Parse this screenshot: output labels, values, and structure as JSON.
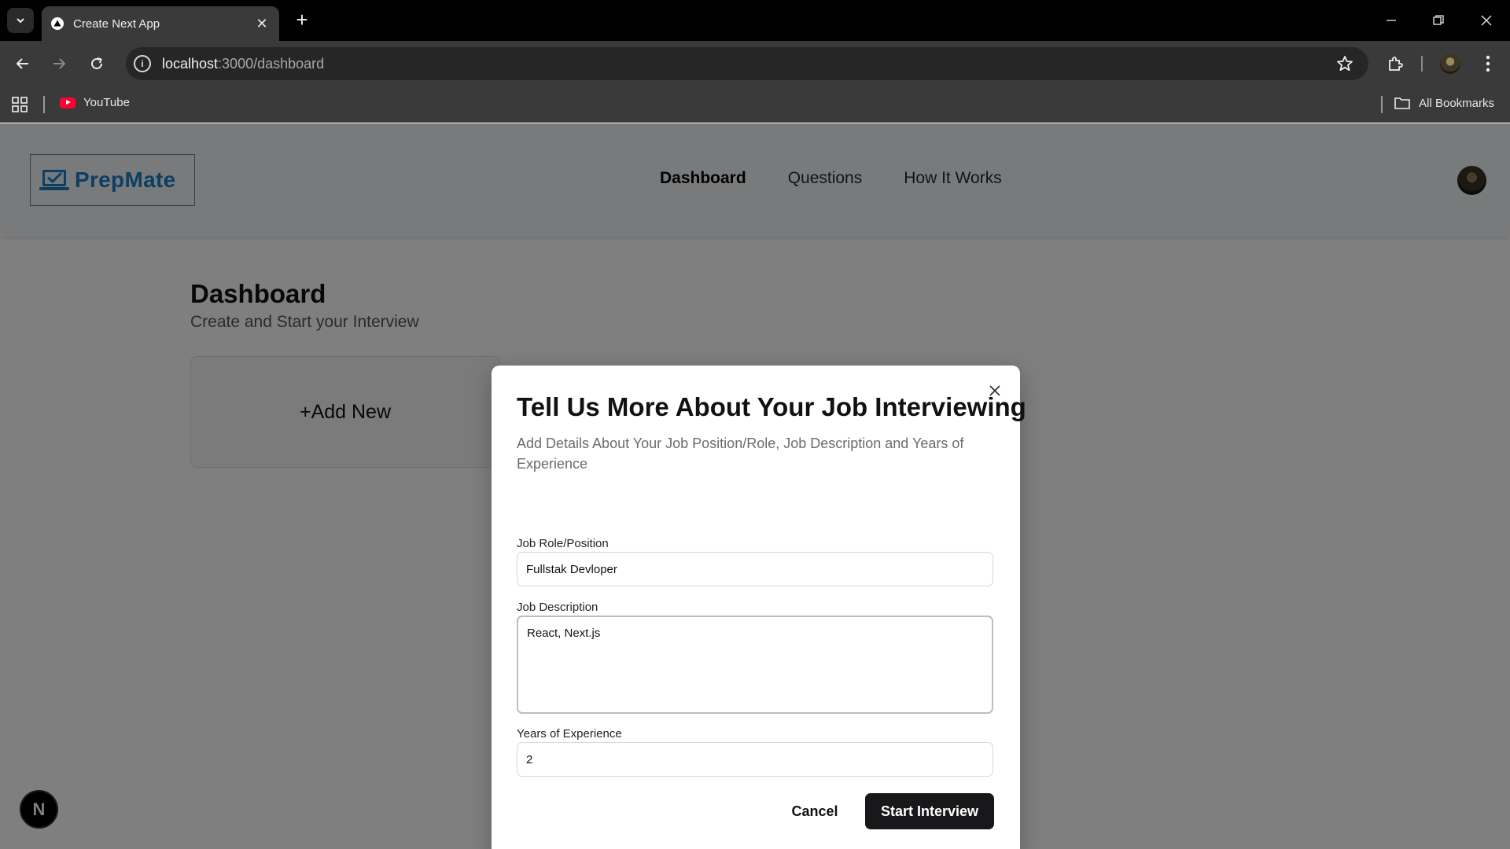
{
  "browser": {
    "tab_title": "Create Next App",
    "url_host": "localhost",
    "url_path": ":3000/dashboard",
    "bookmarks": [
      {
        "label": "YouTube"
      }
    ],
    "all_bookmarks_label": "All Bookmarks"
  },
  "header": {
    "logo_text": "PrepMate",
    "nav": [
      {
        "label": "Dashboard",
        "active": true
      },
      {
        "label": "Questions",
        "active": false
      },
      {
        "label": "How It Works",
        "active": false
      }
    ]
  },
  "dashboard": {
    "title": "Dashboard",
    "subtitle": "Create and Start your Interview",
    "add_new_label": "+Add New"
  },
  "next_badge": "N",
  "modal": {
    "title": "Tell Us More About Your Job Interviewing",
    "description": "Add Details About Your Job Position/Role, Job Description and Years of Experience",
    "fields": {
      "role": {
        "label": "Job Role/Position",
        "value": "Fullstak Devloper"
      },
      "description": {
        "label": "Job Description",
        "value": "React, Next.js"
      },
      "experience": {
        "label": "Years of Experience",
        "value": "2"
      }
    },
    "cancel_label": "Cancel",
    "start_label": "Start Interview"
  },
  "colors": {
    "logo_blue": "#1b7fc4",
    "overlay": "rgba(0,0,0,0.5)",
    "primary_button": "#18181b"
  },
  "icons": [
    "tab-search-icon",
    "nextjs-favicon-icon",
    "close-icon",
    "plus-icon",
    "minimize-icon",
    "restore-icon",
    "window-close-icon",
    "back-arrow-icon",
    "forward-arrow-icon",
    "reload-icon",
    "site-info-icon",
    "star-icon",
    "extensions-icon",
    "profile-icon",
    "kebab-menu-icon",
    "apps-grid-icon",
    "youtube-icon",
    "folder-icon",
    "laptop-check-icon"
  ]
}
